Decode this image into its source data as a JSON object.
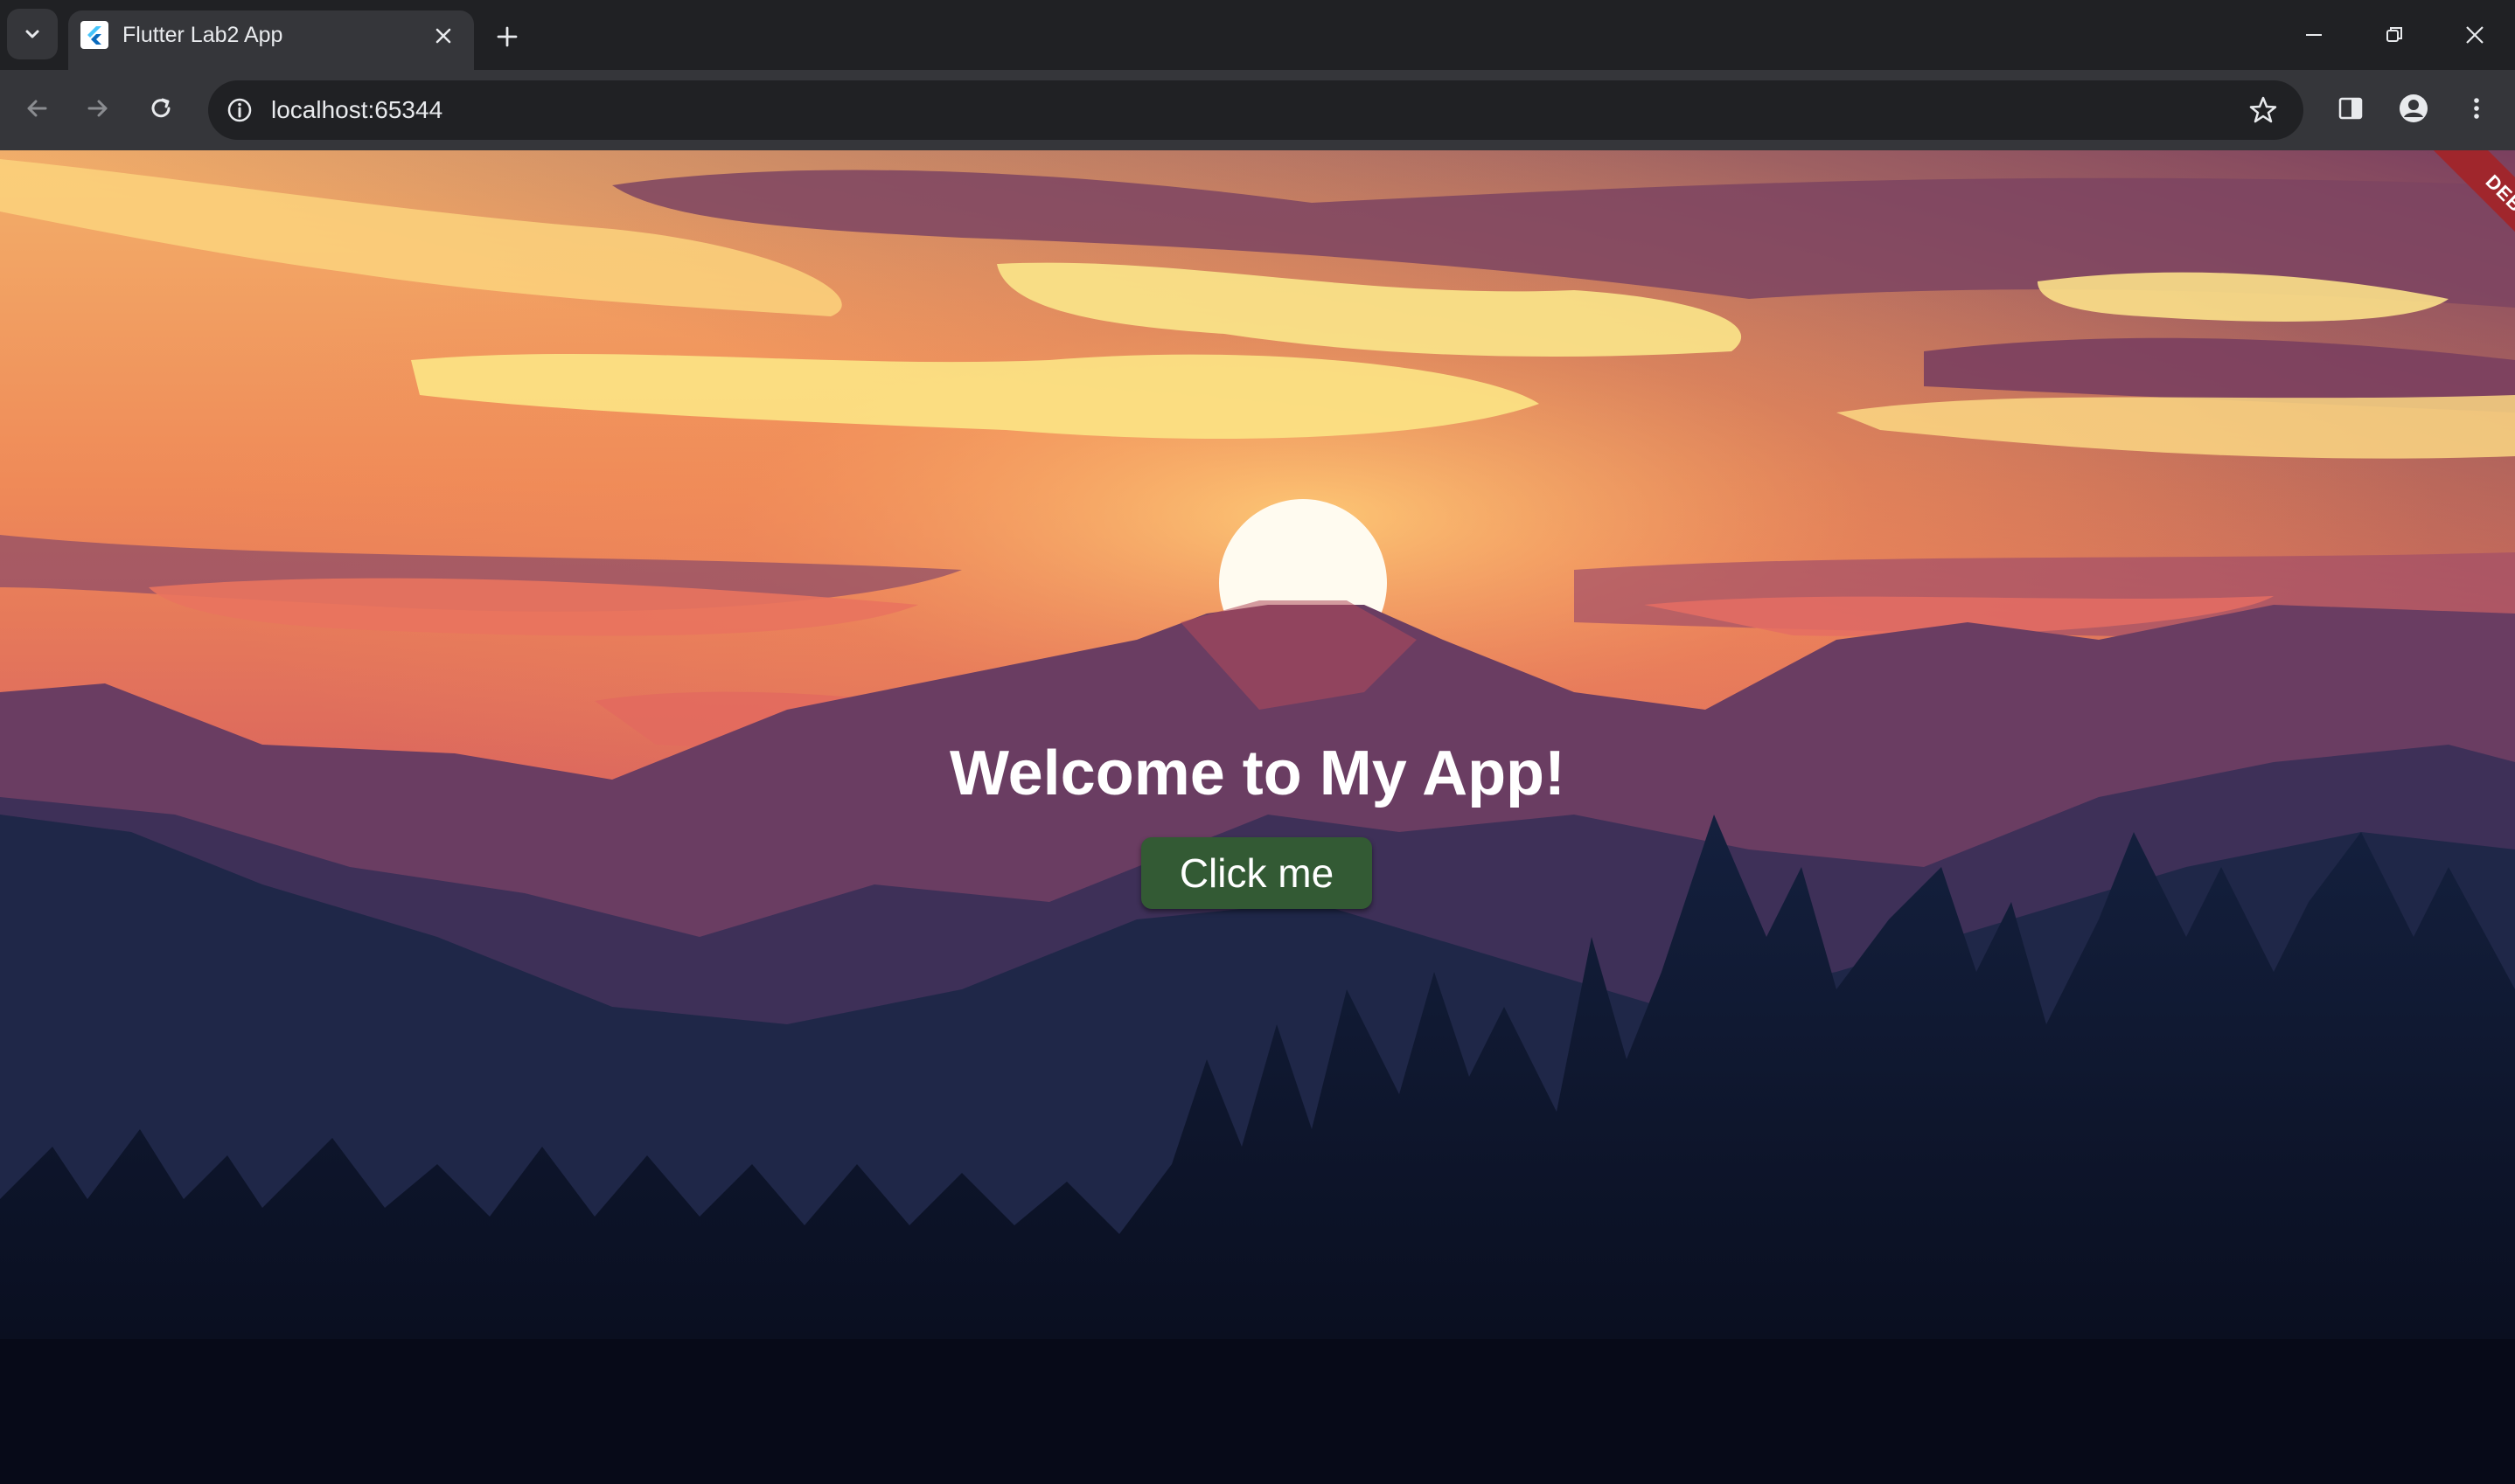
{
  "browser": {
    "tab": {
      "title": "Flutter Lab2 App",
      "favicon": "flutter-logo-icon"
    },
    "address_bar": {
      "url": "localhost:65344"
    },
    "icons": {
      "tab_search": "chevron-down-icon",
      "tab_close": "close-icon",
      "new_tab": "plus-icon",
      "minimize": "minimize-icon",
      "restore": "restore-icon",
      "window_close": "close-icon",
      "back": "arrow-left-icon",
      "forward": "arrow-right-icon",
      "reload": "reload-icon",
      "site_info": "info-icon",
      "bookmark": "star-icon",
      "side_panel": "side-panel-icon",
      "profile": "profile-icon",
      "menu": "kebab-menu-icon"
    },
    "colors": {
      "tabbar": "#202124",
      "toolbar": "#35363a",
      "text": "#e8eaed"
    }
  },
  "app": {
    "heading": "Welcome to My App!",
    "button_label": "Click me",
    "debug_banner": "DEBUG",
    "background": "sunset-mountain-forest-illustration",
    "colors": {
      "button": "#335a34",
      "debug_banner": "#a0262c",
      "heading": "#ffffff"
    }
  }
}
